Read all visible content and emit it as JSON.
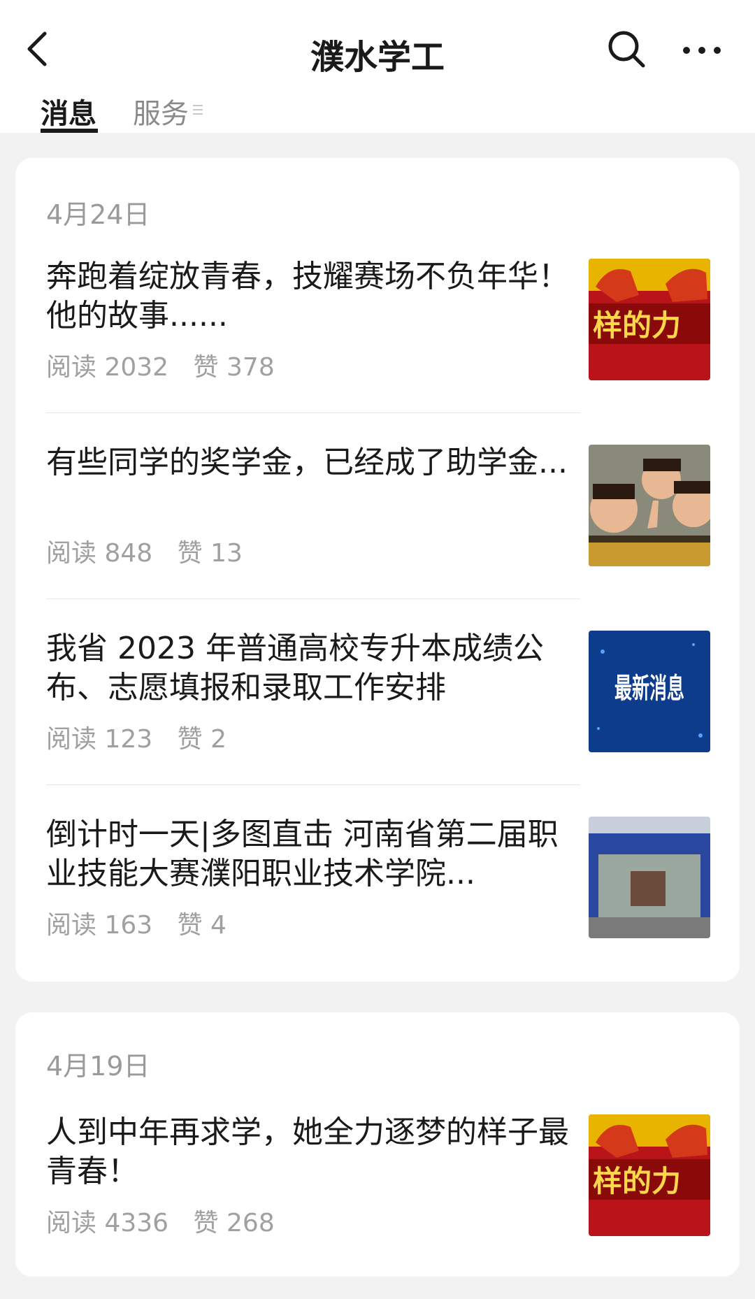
{
  "header": {
    "title": "濮水学工",
    "back_icon": "chevron-left-icon",
    "search_icon": "search-icon",
    "more_icon": "more-dots-icon"
  },
  "tabs": [
    {
      "label": "消息",
      "active": true
    },
    {
      "label": "服务",
      "active": false
    }
  ],
  "groups": [
    {
      "date": "4月24日",
      "articles": [
        {
          "title": "奔跑着绽放青春，技耀赛场不负年华！他的故事......",
          "reads_label": "阅读",
          "reads": "2032",
          "likes_label": "赞",
          "likes": "378",
          "thumb_text": "样的力"
        },
        {
          "title": "有些同学的奖学金，已经成了助学金...",
          "reads_label": "阅读",
          "reads": "848",
          "likes_label": "赞",
          "likes": "13",
          "thumb_text": ""
        },
        {
          "title": "我省 2023 年普通高校专升本成绩公布、志愿填报和录取工作安排",
          "reads_label": "阅读",
          "reads": "123",
          "likes_label": "赞",
          "likes": "2",
          "thumb_text": "最新消息"
        },
        {
          "title": "倒计时一天|多图直击 河南省第二届职业技能大赛濮阳职业技术学院...",
          "reads_label": "阅读",
          "reads": "163",
          "likes_label": "赞",
          "likes": "4",
          "thumb_text": ""
        }
      ]
    },
    {
      "date": "4月19日",
      "articles": [
        {
          "title": "人到中年再求学，她全力逐梦的样子最青春！",
          "reads_label": "阅读",
          "reads": "4336",
          "likes_label": "赞",
          "likes": "268",
          "thumb_text": "样的力"
        }
      ]
    }
  ],
  "colors": {
    "background": "#f2f2f2",
    "card": "#ffffff",
    "primary_text": "#1a1a1a",
    "secondary_text": "#a0a0a0",
    "thumb_red": "#b8141a",
    "thumb_blue": "#0d3c8c"
  }
}
